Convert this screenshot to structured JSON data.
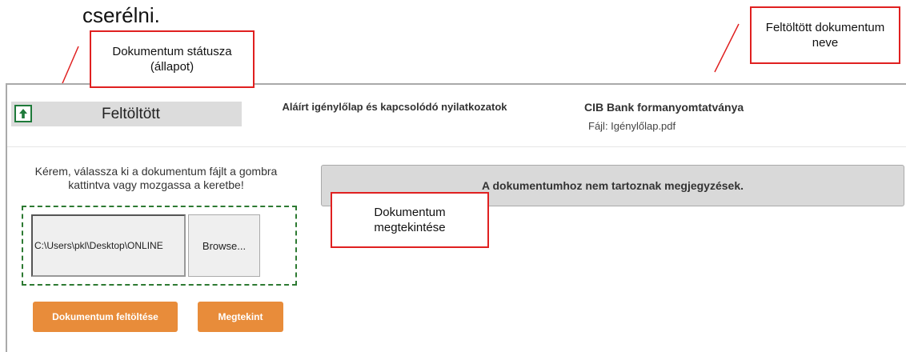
{
  "heading": {
    "text": "cserélni."
  },
  "callouts": {
    "status": "Dokumentum státusza (állapot)",
    "filename": "Feltöltött dokumentum neve",
    "preview": "Dokumentum megtekintése"
  },
  "document": {
    "status_label": "Feltöltött",
    "status_icon": "upload-arrow-icon",
    "type_title": "Aláírt igénylőlap és kapcsolódó nyilatkozatok",
    "form_name": "CIB Bank formanyomtatványa",
    "file_name": "Fájl: Igénylőlap.pdf"
  },
  "upload": {
    "instructions": "Kérem, válassza ki a dokumentum fájlt a gombra kattintva vagy mozgassa a keretbe!",
    "file_path_value": "C:\\Users\\pkl\\Desktop\\ONLINE",
    "browse_label": "Browse...",
    "upload_button_label": "Dokumentum feltöltése",
    "view_button_label": "Megtekint"
  },
  "comments": {
    "empty_message": "A dokumentumhoz nem tartoznak megjegyzések."
  },
  "colors": {
    "accent_orange": "#e88c3a",
    "status_green": "#1e7a3a",
    "dropzone_green": "#2d7a32",
    "callout_red": "#e02020"
  }
}
